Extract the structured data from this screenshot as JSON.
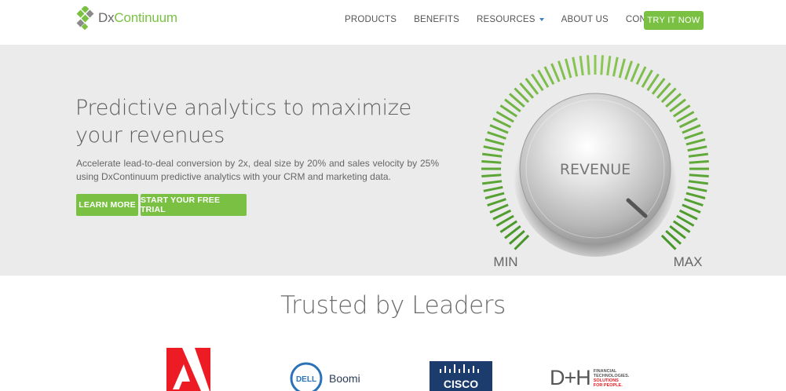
{
  "brand": {
    "name_part1": "Dx",
    "name_part2": "Continuum",
    "accent": "#7ac143"
  },
  "nav": {
    "items": [
      {
        "label": "PRODUCTS"
      },
      {
        "label": "BENEFITS"
      },
      {
        "label": "RESOURCES",
        "has_dropdown": true
      },
      {
        "label": "ABOUT US"
      },
      {
        "label": "CONTACT US"
      }
    ],
    "cta": "TRY IT NOW"
  },
  "hero": {
    "title": "Predictive analytics to maximize your revenues",
    "subtitle": "Accelerate lead-to-deal conversion by 2x, deal size by 20% and sales velocity by 25% using DxContinuum predictive analytics with your CRM and marketing data.",
    "buttons": {
      "learn_more": "LEARN MORE",
      "trial": "START YOUR FREE TRIAL"
    },
    "dial": {
      "label": "REVENUE",
      "min": "MIN",
      "max": "MAX",
      "level_fraction": 0.85
    }
  },
  "trusted": {
    "heading": "Trusted by Leaders",
    "clients": [
      {
        "name": "Adobe",
        "icon": "adobe-logo"
      },
      {
        "name": "Dell Boomi",
        "mark": "DELL",
        "word": "Boomi",
        "icon": "dell-boomi-logo"
      },
      {
        "name": "Cisco",
        "mark": "CISCO",
        "icon": "cisco-logo"
      },
      {
        "name": "D+H",
        "mark": "D+H",
        "tag1": "FINANCIAL",
        "tag2": "TECHNOLOGIES.",
        "tag3": "SOLUTIONS",
        "tag4": "FOR PEOPLE.",
        "icon": "dh-logo"
      }
    ]
  }
}
